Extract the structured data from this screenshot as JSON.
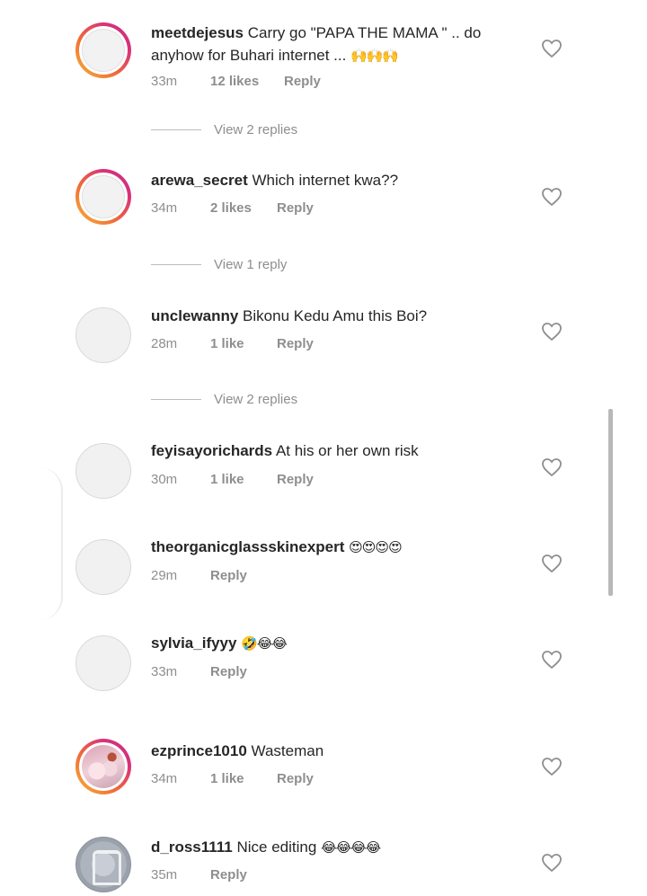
{
  "comments": [
    {
      "username": "meetdejesus",
      "text": "Carry go \"PAPA THE MAMA \" .. do anyhow for Buhari internet ... ",
      "emoji": "🙌🙌🙌",
      "time": "33m",
      "likes": "12 likes",
      "reply": "Reply",
      "avatar": "story-ring"
    },
    {
      "username": "arewa_secret",
      "text": "Which internet kwa??",
      "emoji": "",
      "time": "34m",
      "likes": "2 likes",
      "reply": "Reply",
      "avatar": "story-ring"
    },
    {
      "username": "unclewanny",
      "text": "Bikonu Kedu Amu this Boi?",
      "emoji": "",
      "time": "28m",
      "likes": "1 like",
      "reply": "Reply",
      "avatar": "default"
    },
    {
      "username": "feyisayorichards",
      "text": "At his or her own risk",
      "emoji": "",
      "time": "30m",
      "likes": "1 like",
      "reply": "Reply",
      "avatar": "default"
    },
    {
      "username": "theorganicglassskinexpert",
      "text": "",
      "emoji": "😍😍😍😍",
      "time": "29m",
      "likes": "",
      "reply": "Reply",
      "avatar": "default"
    },
    {
      "username": "sylvia_ifyyy",
      "text": "",
      "emoji": "🤣😂😂",
      "time": "33m",
      "likes": "",
      "reply": "Reply",
      "avatar": "default"
    },
    {
      "username": "ezprince1010",
      "text": "Wasteman",
      "emoji": "",
      "time": "34m",
      "likes": "1 like",
      "reply": "Reply",
      "avatar": "story-ring-photo"
    },
    {
      "username": "d_ross1111",
      "text": "Nice editing ",
      "emoji": "😂😂😂😂",
      "time": "35m",
      "likes": "",
      "reply": "Reply",
      "avatar": "gray-logo"
    }
  ],
  "view_replies": [
    "View 2 replies",
    "View 1 reply",
    "View 2 replies"
  ],
  "icons": {
    "like": "heart-outline-icon"
  },
  "colors": {
    "meta": "#8e8e8e",
    "text": "#262626",
    "ring_start": "#f7b733",
    "ring_end": "#c13584"
  }
}
